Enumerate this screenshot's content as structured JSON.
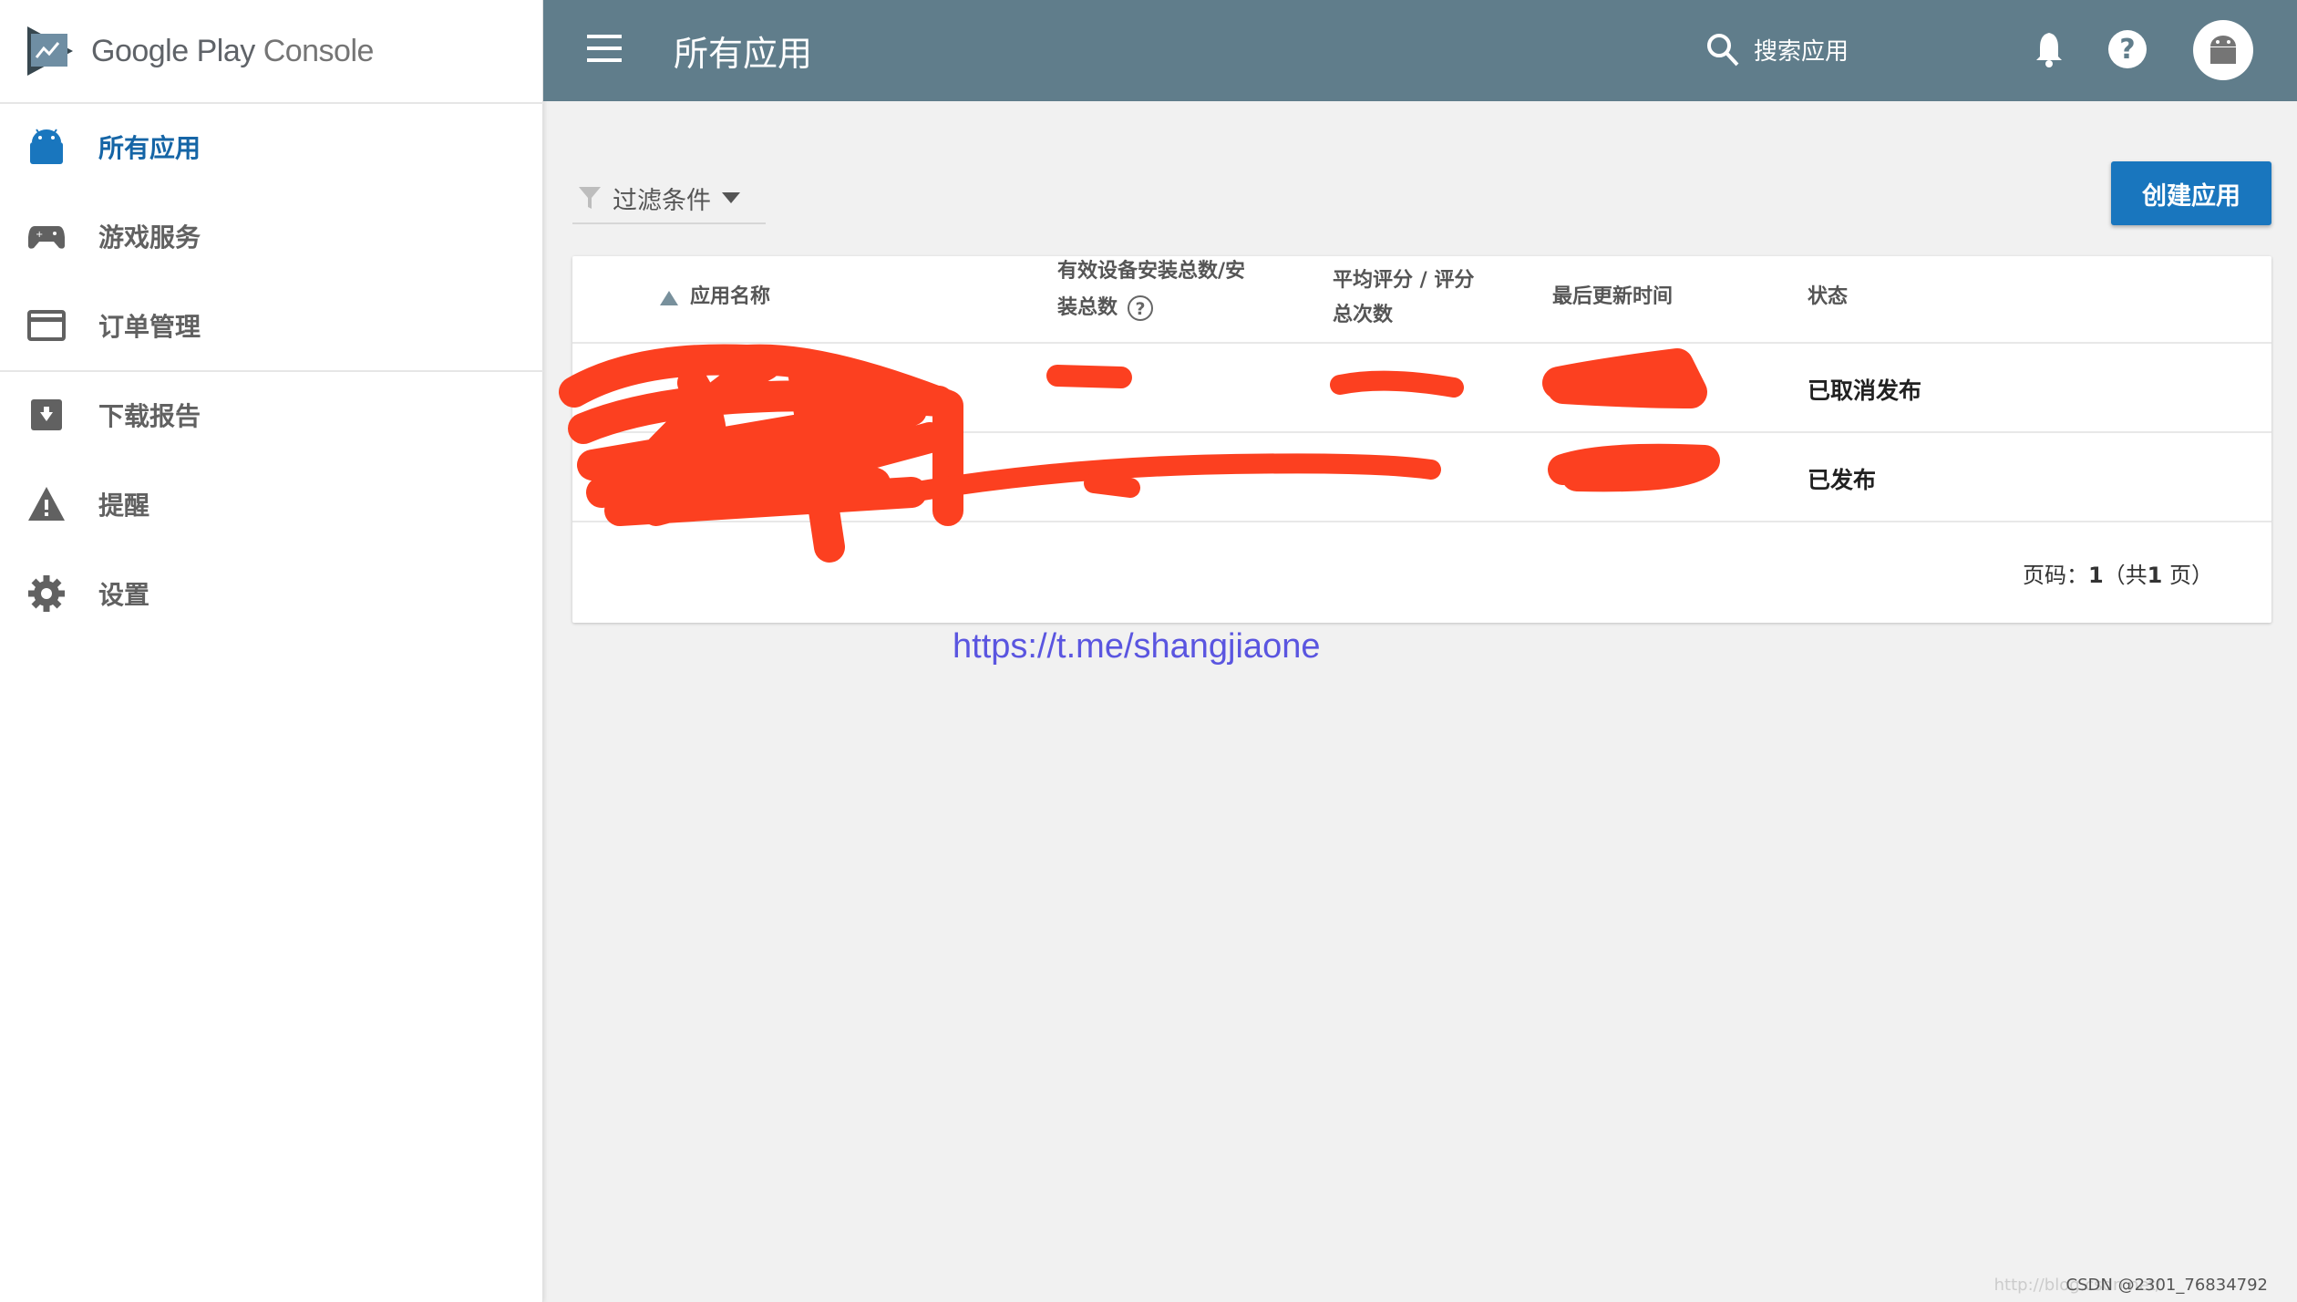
{
  "sidebar": {
    "logo_text_a": "Google Play",
    "logo_text_b": "Console",
    "items": [
      {
        "label": "所有应用",
        "icon": "android-icon",
        "active": true
      },
      {
        "label": "游戏服务",
        "icon": "gamepad-icon"
      },
      {
        "label": "订单管理",
        "icon": "credit-card-icon"
      },
      {
        "label": "下载报告",
        "icon": "download-box-icon"
      },
      {
        "label": "提醒",
        "icon": "warning-icon"
      },
      {
        "label": "设置",
        "icon": "gear-icon"
      }
    ]
  },
  "topbar": {
    "title": "所有应用",
    "search_placeholder": "搜索应用"
  },
  "toolbar": {
    "filter_label": "过滤条件",
    "create_label": "创建应用"
  },
  "table": {
    "headers": [
      "应用名称",
      "有效设备安装总数/安",
      "装总数",
      "平均评分 / 评分",
      "总次数",
      "最后更新时间",
      "状态"
    ],
    "rows": [
      {
        "status": "已取消发布"
      },
      {
        "status": "已发布"
      }
    ],
    "pager": {
      "prefix": "页码：",
      "current": "1",
      "middle": "（共",
      "total": "1",
      "suffix": " 页）"
    }
  },
  "overlay_link": "https://t.me/shangjiaone",
  "watermark": {
    "faint": "http://blog.csdn.net/",
    "text": "CSDN @2301_76834792"
  },
  "colors": {
    "topbar": "#607d8b",
    "accent": "#1976be",
    "scribble": "#fc4020"
  }
}
